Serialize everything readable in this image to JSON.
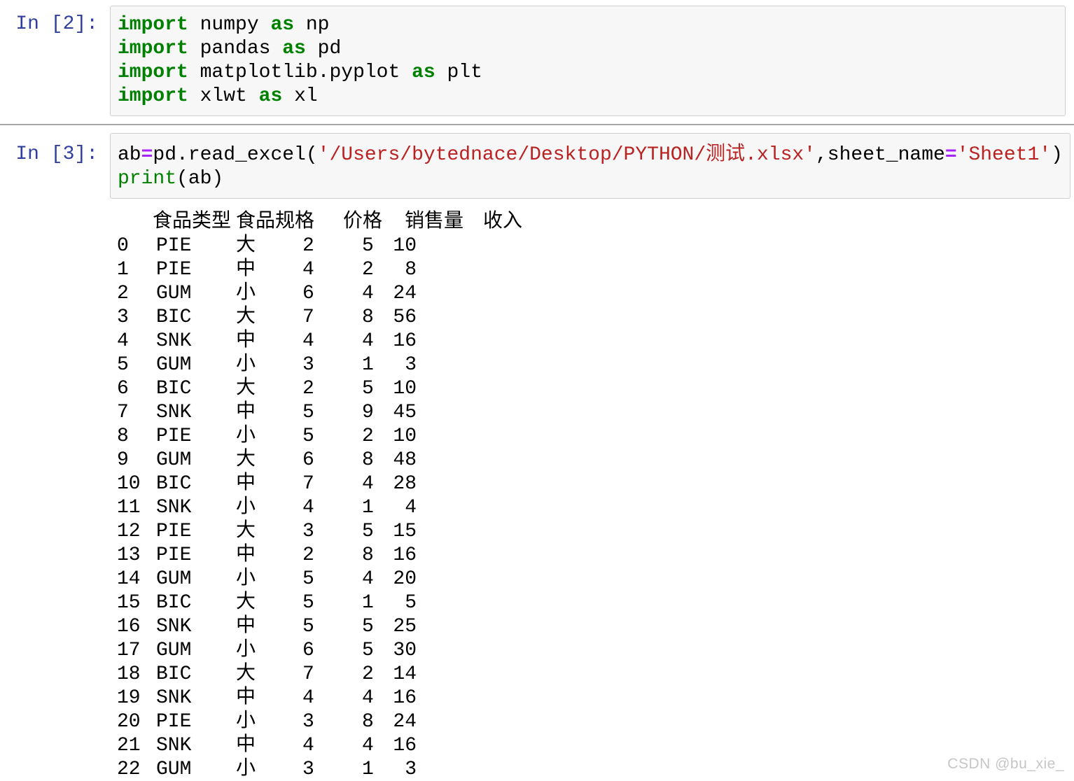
{
  "cells": [
    {
      "prompt": "In [2]:",
      "code_lines": [
        [
          {
            "t": "import",
            "c": "kw"
          },
          {
            "t": " numpy ",
            "c": "pl"
          },
          {
            "t": "as",
            "c": "kw"
          },
          {
            "t": " np",
            "c": "pl"
          }
        ],
        [
          {
            "t": "import",
            "c": "kw"
          },
          {
            "t": " pandas ",
            "c": "pl"
          },
          {
            "t": "as",
            "c": "kw"
          },
          {
            "t": " pd",
            "c": "pl"
          }
        ],
        [
          {
            "t": "import",
            "c": "kw"
          },
          {
            "t": " matplotlib.pyplot ",
            "c": "pl"
          },
          {
            "t": "as",
            "c": "kw"
          },
          {
            "t": " plt",
            "c": "pl"
          }
        ],
        [
          {
            "t": "import",
            "c": "kw"
          },
          {
            "t": " xlwt ",
            "c": "pl"
          },
          {
            "t": "as",
            "c": "kw"
          },
          {
            "t": " xl",
            "c": "pl"
          }
        ]
      ]
    },
    {
      "prompt": "In [3]:",
      "code_lines": [
        [
          {
            "t": "ab",
            "c": "pl"
          },
          {
            "t": "=",
            "c": "op"
          },
          {
            "t": "pd.read_excel(",
            "c": "pl"
          },
          {
            "t": "'/Users/bytednace/Desktop/PYTHON/测试.xlsx'",
            "c": "str"
          },
          {
            "t": ",sheet_name",
            "c": "pl"
          },
          {
            "t": "=",
            "c": "op"
          },
          {
            "t": "'Sheet1'",
            "c": "str"
          },
          {
            "t": ")",
            "c": "pl"
          }
        ],
        [
          {
            "t": "print",
            "c": "bi"
          },
          {
            "t": "(ab)",
            "c": "pl"
          }
        ]
      ]
    }
  ],
  "chart_data": {
    "type": "table",
    "columns": [
      "食品类型",
      "食品规格",
      "价格",
      "销售量",
      "收入"
    ],
    "rows": [
      [
        "0",
        "PIE",
        "大",
        "2",
        "5",
        "10"
      ],
      [
        "1",
        "PIE",
        "中",
        "4",
        "2",
        "8"
      ],
      [
        "2",
        "GUM",
        "小",
        "6",
        "4",
        "24"
      ],
      [
        "3",
        "BIC",
        "大",
        "7",
        "8",
        "56"
      ],
      [
        "4",
        "SNK",
        "中",
        "4",
        "4",
        "16"
      ],
      [
        "5",
        "GUM",
        "小",
        "3",
        "1",
        "3"
      ],
      [
        "6",
        "BIC",
        "大",
        "2",
        "5",
        "10"
      ],
      [
        "7",
        "SNK",
        "中",
        "5",
        "9",
        "45"
      ],
      [
        "8",
        "PIE",
        "小",
        "5",
        "2",
        "10"
      ],
      [
        "9",
        "GUM",
        "大",
        "6",
        "8",
        "48"
      ],
      [
        "10",
        "BIC",
        "中",
        "7",
        "4",
        "28"
      ],
      [
        "11",
        "SNK",
        "小",
        "4",
        "1",
        "4"
      ],
      [
        "12",
        "PIE",
        "大",
        "3",
        "5",
        "15"
      ],
      [
        "13",
        "PIE",
        "中",
        "2",
        "8",
        "16"
      ],
      [
        "14",
        "GUM",
        "小",
        "5",
        "4",
        "20"
      ],
      [
        "15",
        "BIC",
        "大",
        "5",
        "1",
        "5"
      ],
      [
        "16",
        "SNK",
        "中",
        "5",
        "5",
        "25"
      ],
      [
        "17",
        "GUM",
        "小",
        "6",
        "5",
        "30"
      ],
      [
        "18",
        "BIC",
        "大",
        "7",
        "2",
        "14"
      ],
      [
        "19",
        "SNK",
        "中",
        "4",
        "4",
        "16"
      ],
      [
        "20",
        "PIE",
        "小",
        "3",
        "8",
        "24"
      ],
      [
        "21",
        "SNK",
        "中",
        "4",
        "4",
        "16"
      ],
      [
        "22",
        "GUM",
        "小",
        "3",
        "1",
        "3"
      ]
    ]
  },
  "watermark": "CSDN @bu_xie_",
  "colors": {
    "prompt_blue": "#303F9F",
    "keyword_green": "#008000",
    "string_red": "#BA2121",
    "operator_purple": "#AA22FF",
    "cell_background": "#F7F7F7",
    "cell_border": "#CFCFCF",
    "divider_gray": "#A6A6A6",
    "watermark_gray": "#C6C6C6"
  }
}
